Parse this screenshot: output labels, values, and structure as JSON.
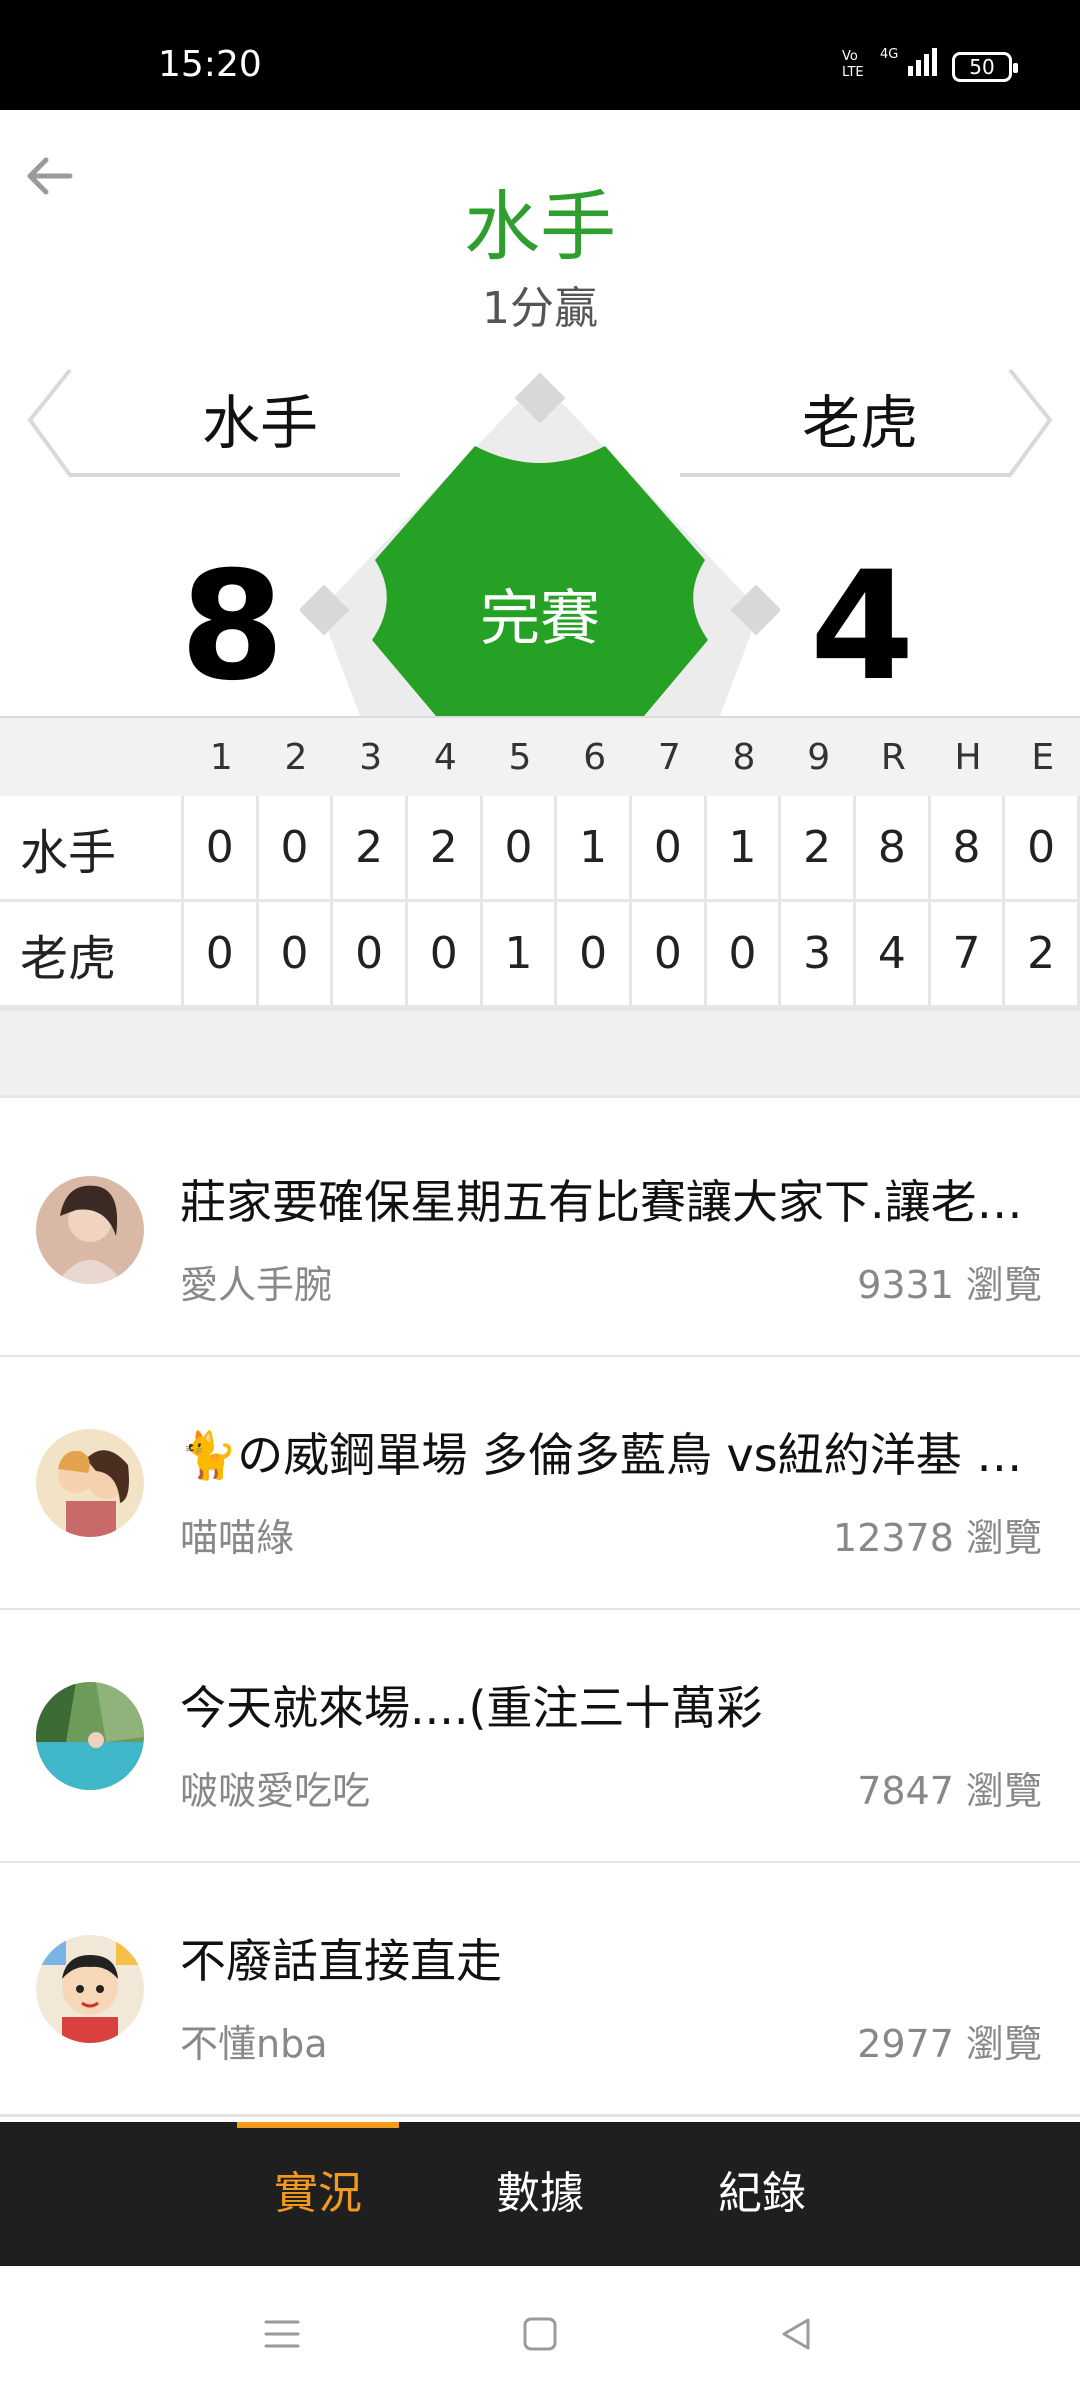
{
  "status_bar": {
    "time": "15:20",
    "signal_label": "4G",
    "volte": "VoLTE",
    "battery": "50"
  },
  "header": {
    "winner": "水手",
    "result": "1分贏"
  },
  "teams": {
    "away": "水手",
    "home": "老虎"
  },
  "scores": {
    "away": "8",
    "home": "4"
  },
  "game_status": "完賽",
  "scoreboard": {
    "columns": [
      "1",
      "2",
      "3",
      "4",
      "5",
      "6",
      "7",
      "8",
      "9",
      "R",
      "H",
      "E"
    ],
    "rows": [
      {
        "team": "水手",
        "values": [
          "0",
          "0",
          "2",
          "2",
          "0",
          "1",
          "0",
          "1",
          "2",
          "8",
          "8",
          "0"
        ]
      },
      {
        "team": "老虎",
        "values": [
          "0",
          "0",
          "0",
          "0",
          "1",
          "0",
          "0",
          "0",
          "3",
          "4",
          "7",
          "2"
        ]
      }
    ]
  },
  "posts": [
    {
      "title": "莊家要確保星期五有比賽讓大家下.讓老…",
      "author": "愛人手腕",
      "views": "9331 瀏覽"
    },
    {
      "title": "🐈の威鋼單場 多倫多藍鳥 vs紐約洋基 …",
      "author": "喵喵綠",
      "views": "12378 瀏覽"
    },
    {
      "title": "今天就來場....(重注三十萬彩",
      "author": "啵啵愛吃吃",
      "views": "7847 瀏覽"
    },
    {
      "title": "不廢話直接直走",
      "author": "不懂nba",
      "views": "2977 瀏覽"
    }
  ],
  "tabs": [
    {
      "label": "實況",
      "active": true
    },
    {
      "label": "數據",
      "active": false
    },
    {
      "label": "紀錄",
      "active": false
    }
  ],
  "colors": {
    "accent_green": "#2e9e2e",
    "diamond_green": "#25a125",
    "tab_active": "#f39a1e",
    "tabbar_bg": "#1f1f1f"
  }
}
